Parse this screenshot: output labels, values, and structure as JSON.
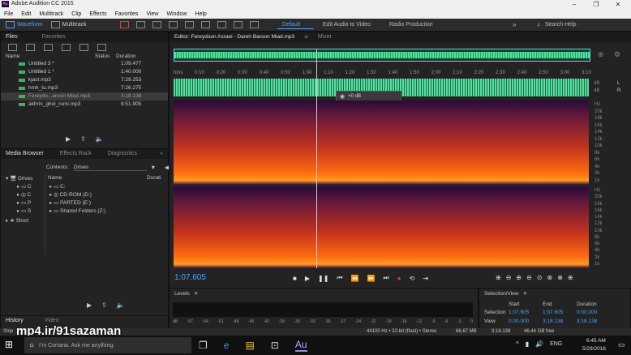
{
  "window": {
    "app_title": "Adobe Audition CC 2015",
    "logo": "Au",
    "minimize": "–",
    "restore": "❐",
    "close": "✕"
  },
  "menu": [
    "File",
    "Edit",
    "Multitrack",
    "Clip",
    "Effects",
    "Favorites",
    "View",
    "Window",
    "Help"
  ],
  "toolbar": {
    "waveform": "Waveform",
    "multitrack": "Multitrack",
    "workspaces": [
      "Default",
      "Edit Audio to Video",
      "Radio Production"
    ],
    "search": "Search Help"
  },
  "files_panel": {
    "tabs": [
      "Files",
      "Favorites"
    ],
    "columns": {
      "name": "Name",
      "status": "Status",
      "duration": "Duration"
    },
    "items": [
      {
        "name": "Untitled 3 *",
        "duration": "1:09.477"
      },
      {
        "name": "Untitled 1 *",
        "duration": "1:40.000"
      },
      {
        "name": "kjast.mp3",
        "duration": "7:29.253"
      },
      {
        "name": "hmh_tu.mp3",
        "duration": "7:26.275"
      },
      {
        "name": "Fereydo...aroon Miad.mp3",
        "duration": "3:18.138",
        "selected": true
      },
      {
        "name": "akhrin_ghol_rumi.mp3",
        "duration": "8:51.905"
      }
    ]
  },
  "media_browser": {
    "tabs": [
      "Media Browser",
      "Effects Rack",
      "Diagnostics"
    ],
    "contents_label": "Contents:",
    "contents_value": "Drives",
    "columns": {
      "name": "Name",
      "duration": "Durati"
    },
    "tree": [
      "Drives",
      "C",
      "C",
      "P",
      "S",
      "Short"
    ],
    "items": [
      "C:",
      "CD-ROM (D:)",
      "PARTED (E:)",
      "Shared Folders (Z:)"
    ]
  },
  "history_panel": {
    "tabs": [
      "History",
      "Video"
    ],
    "status": "Stop"
  },
  "editor": {
    "tabs": [
      "Editor: Fereydoun Asraei - Dareh Baroon Miad.mp3",
      "Mixer"
    ],
    "timeline": [
      "hms",
      "0:10",
      "0:20",
      "0:30",
      "0:40",
      "0:50",
      "1:00",
      "1:10",
      "1:20",
      "1:30",
      "1:40",
      "1:50",
      "2:00",
      "2:10",
      "2:20",
      "2:30",
      "2:40",
      "2:50",
      "3:00",
      "3:10"
    ],
    "hud_db": "+0 dB",
    "freq_labels_top": [
      "Hz",
      "20k",
      "18k",
      "16k",
      "14k",
      "12k",
      "10k",
      "8k",
      "6k",
      "4k",
      "2k",
      "1k"
    ],
    "freq_labels_bottom": [
      "Hz",
      "20k",
      "18k",
      "16k",
      "14k",
      "12k",
      "10k",
      "8k",
      "6k",
      "4k",
      "2k",
      "1k"
    ],
    "db_label": "dB",
    "channel_l": "L",
    "channel_r": "R",
    "time_display": "1:07.605"
  },
  "levels": {
    "title": "Levels",
    "scale": [
      "dB",
      "-57",
      "-54",
      "-51",
      "-48",
      "-45",
      "-42",
      "-39",
      "-36",
      "-33",
      "-30",
      "-27",
      "-24",
      "-21",
      "-18",
      "-15",
      "-12",
      "-9",
      "-6",
      "-3",
      "0"
    ]
  },
  "selection_view": {
    "title": "Selection/View",
    "headers": [
      "Start",
      "End",
      "Duration"
    ],
    "rows": [
      {
        "label": "Selection",
        "start": "1:07.605",
        "end": "1:07.605",
        "duration": "0:00.000"
      },
      {
        "label": "View",
        "start": "0:00.000",
        "end": "3:18.138",
        "duration": "3:18.138"
      }
    ]
  },
  "status": {
    "format": "44100 Hz • 32-bit (float) • Stereo",
    "size": "66.67 MB",
    "duration": "3:18.138",
    "free": "46.44 GB free"
  },
  "watermark": "mp4.ir/91sazaman",
  "taskbar": {
    "cortana": "I'm Cortana. Ask me anything.",
    "time": "6:45 AM",
    "date": "5/29/2016",
    "lang": "ENG"
  }
}
